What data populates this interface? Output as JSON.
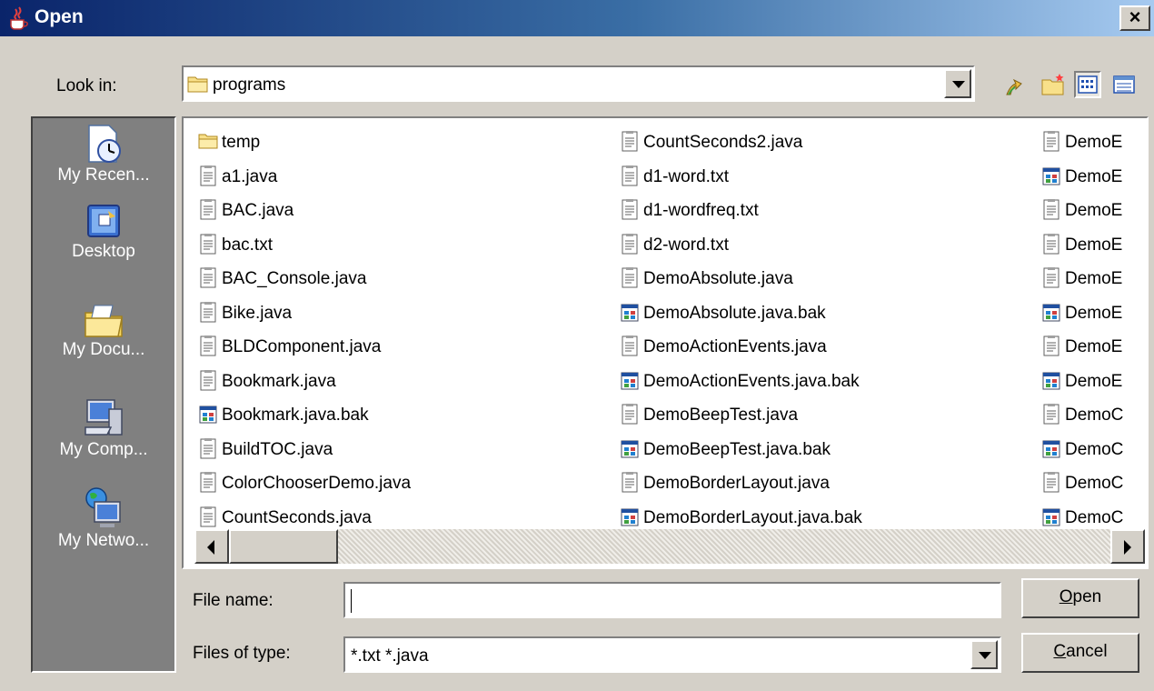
{
  "window": {
    "title": "Open",
    "close_label": "×"
  },
  "lookin": {
    "label": "Look in:",
    "value": "programs"
  },
  "places": [
    {
      "label": "My Recen...",
      "icon": "recent-documents-icon"
    },
    {
      "label": "Desktop",
      "icon": "desktop-icon"
    },
    {
      "label": "My Docu...",
      "icon": "my-documents-icon"
    },
    {
      "label": "My Comp...",
      "icon": "my-computer-icon"
    },
    {
      "label": "My Netwo...",
      "icon": "my-network-icon"
    }
  ],
  "files": {
    "col1": [
      {
        "name": "temp",
        "type": "folder"
      },
      {
        "name": "a1.java",
        "type": "text"
      },
      {
        "name": "BAC.java",
        "type": "text"
      },
      {
        "name": "bac.txt",
        "type": "text"
      },
      {
        "name": "BAC_Console.java",
        "type": "text"
      },
      {
        "name": "Bike.java",
        "type": "text"
      },
      {
        "name": "BLDComponent.java",
        "type": "text"
      },
      {
        "name": "Bookmark.java",
        "type": "text"
      },
      {
        "name": "Bookmark.java.bak",
        "type": "bak"
      },
      {
        "name": "BuildTOC.java",
        "type": "text"
      },
      {
        "name": "ColorChooserDemo.java",
        "type": "text"
      },
      {
        "name": "CountSeconds.java",
        "type": "text"
      }
    ],
    "col2": [
      {
        "name": "CountSeconds2.java",
        "type": "text"
      },
      {
        "name": "d1-word.txt",
        "type": "text"
      },
      {
        "name": "d1-wordfreq.txt",
        "type": "text"
      },
      {
        "name": "d2-word.txt",
        "type": "text"
      },
      {
        "name": "DemoAbsolute.java",
        "type": "text"
      },
      {
        "name": "DemoAbsolute.java.bak",
        "type": "bak"
      },
      {
        "name": "DemoActionEvents.java",
        "type": "text"
      },
      {
        "name": "DemoActionEvents.java.bak",
        "type": "bak"
      },
      {
        "name": "DemoBeepTest.java",
        "type": "text"
      },
      {
        "name": "DemoBeepTest.java.bak",
        "type": "bak"
      },
      {
        "name": "DemoBorderLayout.java",
        "type": "text"
      },
      {
        "name": "DemoBorderLayout.java.bak",
        "type": "bak"
      }
    ],
    "col3": [
      {
        "name": "DemoE",
        "type": "text"
      },
      {
        "name": "DemoE",
        "type": "bak"
      },
      {
        "name": "DemoE",
        "type": "text"
      },
      {
        "name": "DemoE",
        "type": "text"
      },
      {
        "name": "DemoE",
        "type": "text"
      },
      {
        "name": "DemoE",
        "type": "bak"
      },
      {
        "name": "DemoE",
        "type": "text"
      },
      {
        "name": "DemoE",
        "type": "bak"
      },
      {
        "name": "DemoC",
        "type": "text"
      },
      {
        "name": "DemoC",
        "type": "bak"
      },
      {
        "name": "DemoC",
        "type": "text"
      },
      {
        "name": "DemoC",
        "type": "bak"
      }
    ]
  },
  "filename": {
    "label": "File name:",
    "value": ""
  },
  "filetype": {
    "label": "Files of type:",
    "value": "*.txt *.java"
  },
  "buttons": {
    "open": {
      "mnemonic": "O",
      "rest": "pen"
    },
    "cancel": {
      "mnemonic": "C",
      "rest": "ancel"
    }
  }
}
